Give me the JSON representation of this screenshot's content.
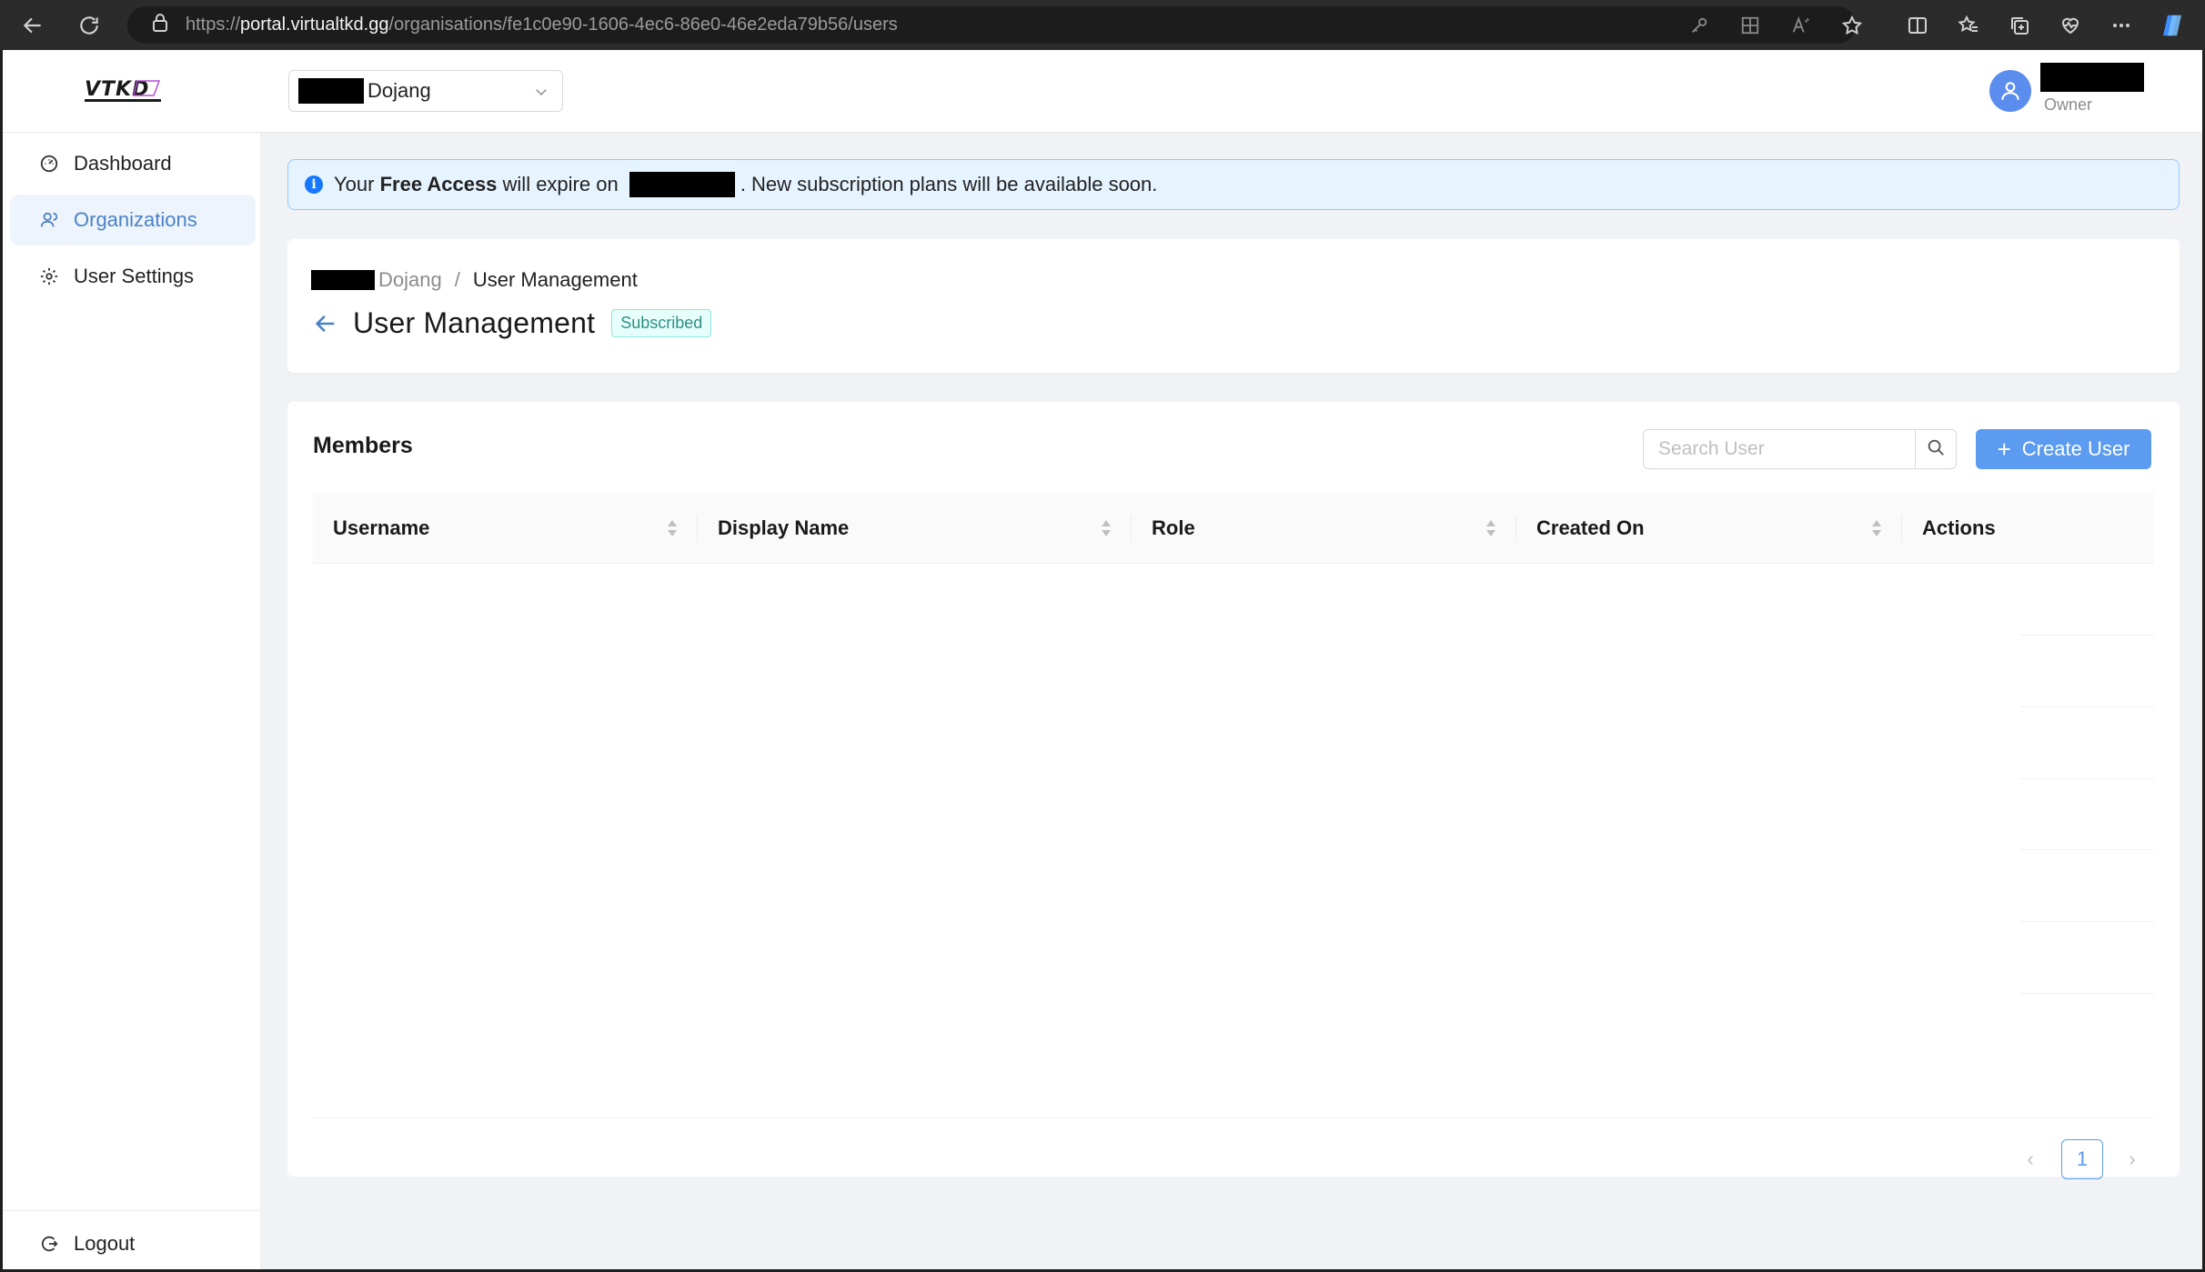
{
  "browser": {
    "url_prefix": "https://",
    "url_host": "portal.virtualtkd.gg",
    "url_path": "/organisations/fe1c0e90-1606-4ec6-86e0-46e2eda79b56/users"
  },
  "header": {
    "org_select_label": "Dojang",
    "user_role": "Owner"
  },
  "sidebar": {
    "items": [
      {
        "label": "Dashboard",
        "icon": "dashboard-icon"
      },
      {
        "label": "Organizations",
        "icon": "organizations-icon"
      },
      {
        "label": "User Settings",
        "icon": "gear-icon"
      }
    ],
    "logout_label": "Logout"
  },
  "alert": {
    "prefix": "Your ",
    "emphasis": "Free Access",
    "middle": " will expire on ",
    "suffix": ". New subscription plans will be available soon."
  },
  "page": {
    "breadcrumb_org": "Dojang",
    "breadcrumb_sep": "/",
    "breadcrumb_current": "User Management",
    "title": "User Management",
    "badge": "Subscribed"
  },
  "members": {
    "title": "Members",
    "search_placeholder": "Search User",
    "create_label": "Create User",
    "columns": [
      "Username",
      "Display Name",
      "Role",
      "Created On",
      "Actions"
    ],
    "current_page": "1",
    "prev_glyph": "‹",
    "next_glyph": "›"
  },
  "colors": {
    "accent": "#5b9bf0",
    "active_bg": "#eef4fb",
    "badge_text": "#2f8f83",
    "alert_bg": "#e6f4ff"
  }
}
